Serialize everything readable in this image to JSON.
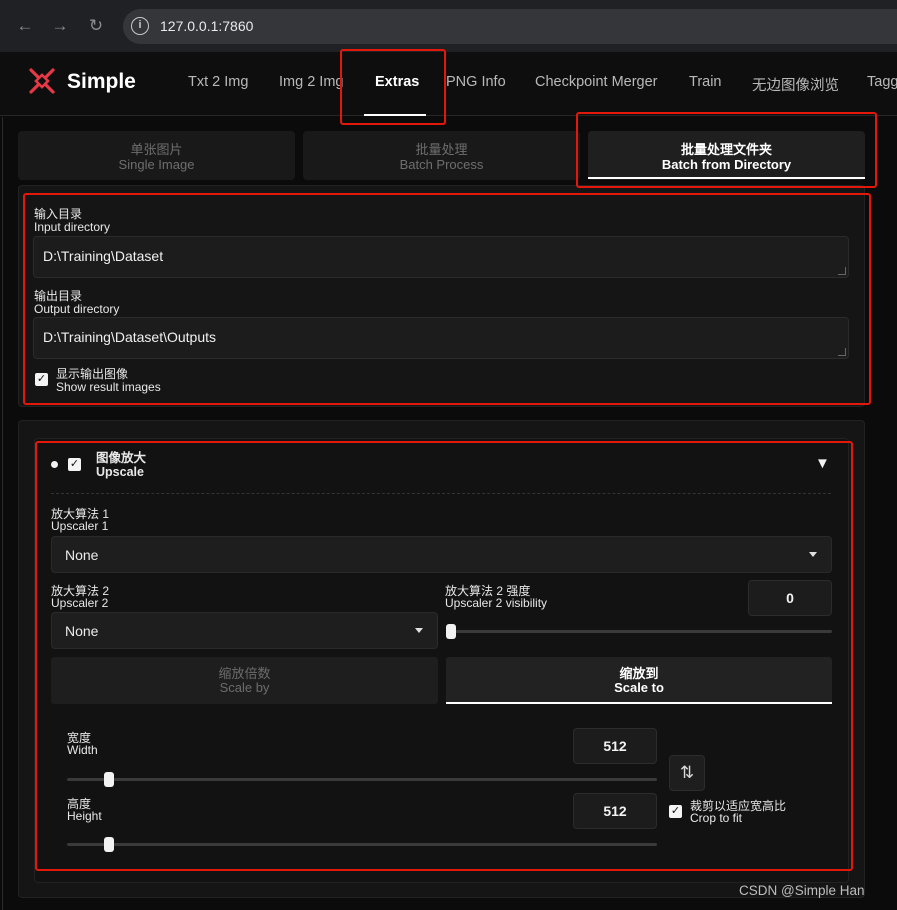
{
  "browser": {
    "url": "127.0.0.1:7860",
    "back_icon": "←",
    "forward_icon": "→",
    "reload_icon": "↻"
  },
  "app": {
    "brand": "Simple",
    "accent": "#e63946"
  },
  "nav": {
    "tabs": [
      "Txt 2 Img",
      "Img 2 Img",
      "Extras",
      "PNG Info",
      "Checkpoint Merger",
      "Train",
      "无边图像浏览",
      "Tagg"
    ],
    "active": "Extras"
  },
  "subtabs": [
    {
      "zh": "单张图片",
      "en": "Single Image"
    },
    {
      "zh": "批量处理",
      "en": "Batch Process"
    },
    {
      "zh": "批量处理文件夹",
      "en": "Batch from Directory"
    }
  ],
  "input_dir": {
    "label_zh": "输入目录",
    "label_en": "Input directory",
    "value": "D:\\Training\\Dataset"
  },
  "output_dir": {
    "label_zh": "输出目录",
    "label_en": "Output directory",
    "value": "D:\\Training\\Dataset\\Outputs"
  },
  "show_results": {
    "label_zh": "显示输出图像",
    "label_en": "Show result images",
    "checked": true
  },
  "upscale": {
    "title_zh": "图像放大",
    "title_en": "Upscale",
    "enabled": true,
    "collapse_icon": "▼",
    "upscaler1": {
      "label_zh": "放大算法 1",
      "label_en": "Upscaler 1",
      "value": "None"
    },
    "upscaler2": {
      "label_zh": "放大算法 2",
      "label_en": "Upscaler 2",
      "value": "None"
    },
    "visibility": {
      "label_zh": "放大算法 2 强度",
      "label_en": "Upscaler 2 visibility",
      "value": "0",
      "fraction": 0
    },
    "scale_by": {
      "zh": "缩放倍数",
      "en": "Scale by"
    },
    "scale_to": {
      "zh": "缩放到",
      "en": "Scale to"
    },
    "width": {
      "label_zh": "宽度",
      "label_en": "Width",
      "value": "512",
      "fraction": 0.063
    },
    "height": {
      "label_zh": "高度",
      "label_en": "Height",
      "value": "512",
      "fraction": 0.063
    },
    "swap_icon": "⇅",
    "crop": {
      "label_zh": "裁剪以适应宽高比",
      "label_en": "Crop to fit",
      "checked": true
    }
  },
  "watermark": "CSDN @Simple Han"
}
